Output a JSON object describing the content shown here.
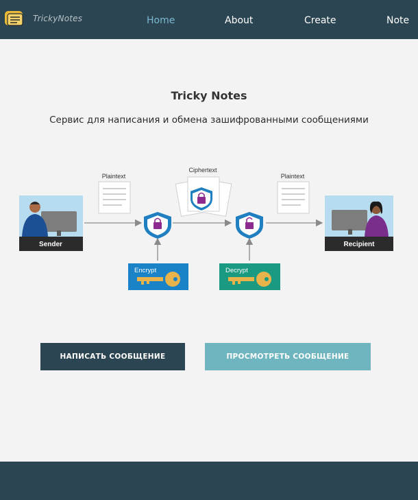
{
  "nav": {
    "brand": "TrickyNotes",
    "links": [
      "Home",
      "About",
      "Create",
      "Note"
    ],
    "active": "Home"
  },
  "hero": {
    "title": "Tricky Notes",
    "subtitle": "Сервис для написания и обмена зашифрованными сообщениями"
  },
  "diagram": {
    "sender_label": "Sender",
    "recipient_label": "Recipient",
    "plaintext_left": "Plaintext",
    "ciphertext": "Ciphertext",
    "plaintext_right": "Plaintext",
    "encrypt_label": "Encrypt",
    "decrypt_label": "Decrypt"
  },
  "buttons": {
    "write": "НАПИСАТЬ СООБЩЕНИЕ",
    "view": "ПРОСМОТРЕТЬ СООБЩЕНИЕ"
  },
  "colors": {
    "navbar": "#2b4552",
    "active_link": "#7bb8cf",
    "write_button": "#2b4552",
    "view_button": "#6fb5bf",
    "encrypt_key_bg": "#1a83c8",
    "decrypt_key_bg": "#1b9a82"
  },
  "icons": [
    "notes-logo-icon",
    "shield-lock-icon",
    "key-icon",
    "document-icon",
    "person-at-computer-icon"
  ]
}
